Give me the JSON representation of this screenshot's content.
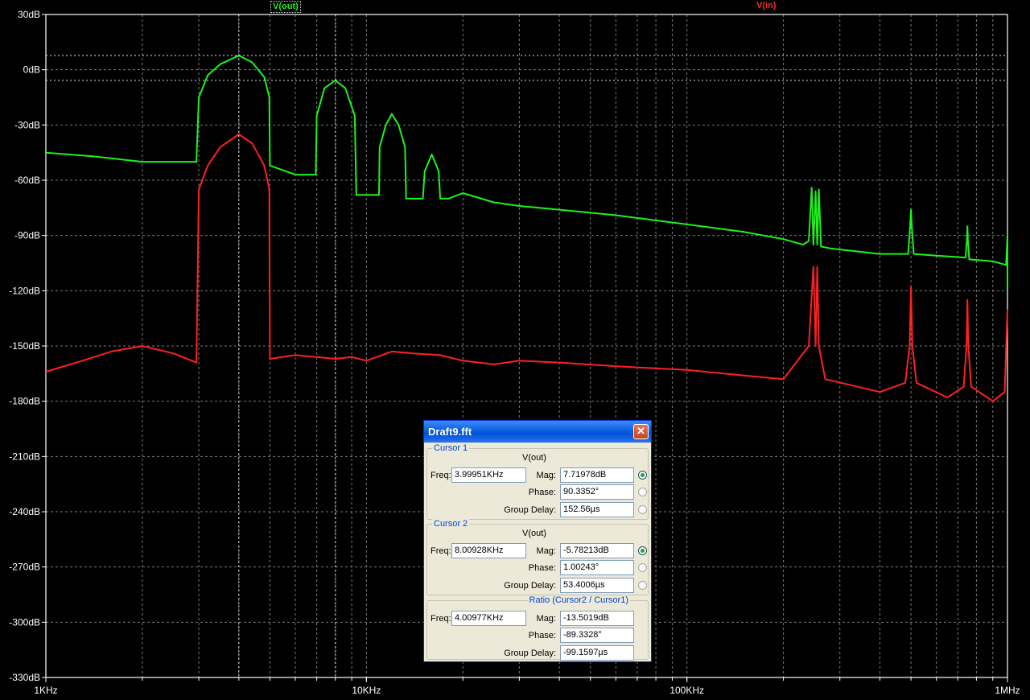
{
  "chart_data": {
    "type": "line",
    "x_scale": "log",
    "xlim": [
      1000,
      1000000
    ],
    "ylim": [
      -330,
      30
    ],
    "y_ticks": [
      "30dB",
      "0dB",
      "-30dB",
      "-60dB",
      "-90dB",
      "-120dB",
      "-150dB",
      "-180dB",
      "-210dB",
      "-240dB",
      "-270dB",
      "-300dB",
      "-330dB"
    ],
    "y_tick_values": [
      30,
      0,
      -30,
      -60,
      -90,
      -120,
      -150,
      -180,
      -210,
      -240,
      -270,
      -300,
      -330
    ],
    "x_ticks": [
      "1KHz",
      "10KHz",
      "100KHz",
      "1MHz"
    ],
    "x_tick_values": [
      1000,
      10000,
      100000,
      1000000
    ],
    "grid": true,
    "series": [
      {
        "name": "V(out)",
        "color": "#1cf21c",
        "points": [
          [
            1000,
            -45
          ],
          [
            1400,
            -47
          ],
          [
            2000,
            -50
          ],
          [
            2950,
            -50
          ],
          [
            3000,
            -15
          ],
          [
            3200,
            -3
          ],
          [
            3500,
            3
          ],
          [
            4000,
            7.7
          ],
          [
            4400,
            4
          ],
          [
            4800,
            -4
          ],
          [
            4980,
            -15
          ],
          [
            5000,
            -52
          ],
          [
            6000,
            -57
          ],
          [
            6950,
            -57
          ],
          [
            7000,
            -25
          ],
          [
            7400,
            -10
          ],
          [
            8000,
            -5.8
          ],
          [
            8600,
            -10
          ],
          [
            9200,
            -25
          ],
          [
            9300,
            -68
          ],
          [
            10000,
            -68
          ],
          [
            10950,
            -68
          ],
          [
            11000,
            -42
          ],
          [
            11500,
            -30
          ],
          [
            12000,
            -24
          ],
          [
            12600,
            -30
          ],
          [
            13200,
            -42
          ],
          [
            13300,
            -70
          ],
          [
            15000,
            -70
          ],
          [
            15200,
            -55
          ],
          [
            16000,
            -46
          ],
          [
            16800,
            -55
          ],
          [
            17000,
            -70
          ],
          [
            18000,
            -70
          ],
          [
            20000,
            -67
          ],
          [
            25000,
            -72
          ],
          [
            30000,
            -74
          ],
          [
            40000,
            -76
          ],
          [
            60000,
            -79
          ],
          [
            100000,
            -84
          ],
          [
            150000,
            -88
          ],
          [
            200000,
            -92
          ],
          [
            230000,
            -95
          ],
          [
            240000,
            -93
          ],
          [
            245000,
            -64
          ],
          [
            248000,
            -95
          ],
          [
            252000,
            -66
          ],
          [
            255000,
            -95
          ],
          [
            258000,
            -65
          ],
          [
            262000,
            -96
          ],
          [
            280000,
            -97
          ],
          [
            400000,
            -100
          ],
          [
            490000,
            -100
          ],
          [
            497000,
            -85
          ],
          [
            500000,
            -76
          ],
          [
            503000,
            -85
          ],
          [
            510000,
            -100
          ],
          [
            600000,
            -101
          ],
          [
            740000,
            -102
          ],
          [
            747000,
            -93
          ],
          [
            750000,
            -85
          ],
          [
            753000,
            -93
          ],
          [
            760000,
            -103
          ],
          [
            900000,
            -104
          ],
          [
            990000,
            -106
          ],
          [
            1000000,
            -90
          ],
          [
            1000000,
            -120
          ]
        ]
      },
      {
        "name": "V(in)",
        "color": "#ff2020",
        "points": [
          [
            1000,
            -164
          ],
          [
            1300,
            -158
          ],
          [
            1600,
            -153
          ],
          [
            2000,
            -150
          ],
          [
            2500,
            -154
          ],
          [
            2950,
            -159
          ],
          [
            3000,
            -65
          ],
          [
            3200,
            -52
          ],
          [
            3500,
            -42
          ],
          [
            4000,
            -35
          ],
          [
            4400,
            -40
          ],
          [
            4800,
            -52
          ],
          [
            4980,
            -65
          ],
          [
            5000,
            -157
          ],
          [
            6000,
            -155
          ],
          [
            7000,
            -156
          ],
          [
            8000,
            -157
          ],
          [
            9000,
            -156
          ],
          [
            10000,
            -158
          ],
          [
            12000,
            -153
          ],
          [
            14000,
            -154
          ],
          [
            17000,
            -155
          ],
          [
            20000,
            -158
          ],
          [
            25000,
            -160
          ],
          [
            30000,
            -158
          ],
          [
            40000,
            -159
          ],
          [
            60000,
            -161
          ],
          [
            100000,
            -163
          ],
          [
            150000,
            -166
          ],
          [
            200000,
            -168
          ],
          [
            240000,
            -150
          ],
          [
            248000,
            -107
          ],
          [
            252000,
            -150
          ],
          [
            255000,
            -107
          ],
          [
            258000,
            -150
          ],
          [
            270000,
            -168
          ],
          [
            400000,
            -175
          ],
          [
            480000,
            -170
          ],
          [
            495000,
            -150
          ],
          [
            500000,
            -118
          ],
          [
            505000,
            -150
          ],
          [
            520000,
            -170
          ],
          [
            650000,
            -178
          ],
          [
            730000,
            -172
          ],
          [
            745000,
            -150
          ],
          [
            750000,
            -125
          ],
          [
            755000,
            -150
          ],
          [
            770000,
            -172
          ],
          [
            900000,
            -180
          ],
          [
            980000,
            -175
          ],
          [
            1000000,
            -130
          ]
        ]
      }
    ]
  },
  "dialog": {
    "title": "Draft9.fft",
    "close_glyph": "✕",
    "cursor1": {
      "group": "Cursor 1",
      "trace": "V(out)",
      "freq_label": "Freq:",
      "freq": "3.99951KHz",
      "mag_label": "Mag:",
      "mag": "7.71978dB",
      "phase_label": "Phase:",
      "phase": "90.3352°",
      "gd_label": "Group Delay:",
      "gd": "152.56µs"
    },
    "cursor2": {
      "group": "Cursor 2",
      "trace": "V(out)",
      "freq_label": "Freq:",
      "freq": "8.00928KHz",
      "mag_label": "Mag:",
      "mag": "-5.78213dB",
      "phase_label": "Phase:",
      "phase": "1.00243°",
      "gd_label": "Group Delay:",
      "gd": "53.4006µs"
    },
    "ratio": {
      "group": "Ratio (Cursor2 / Cursor1)",
      "freq_label": "Freq:",
      "freq": "4.00977KHz",
      "mag_label": "Mag:",
      "mag": "-13.5019dB",
      "phase_label": "Phase:",
      "phase": "-89.3328°",
      "gd_label": "Group Delay:",
      "gd": "-99.1597µs"
    }
  }
}
